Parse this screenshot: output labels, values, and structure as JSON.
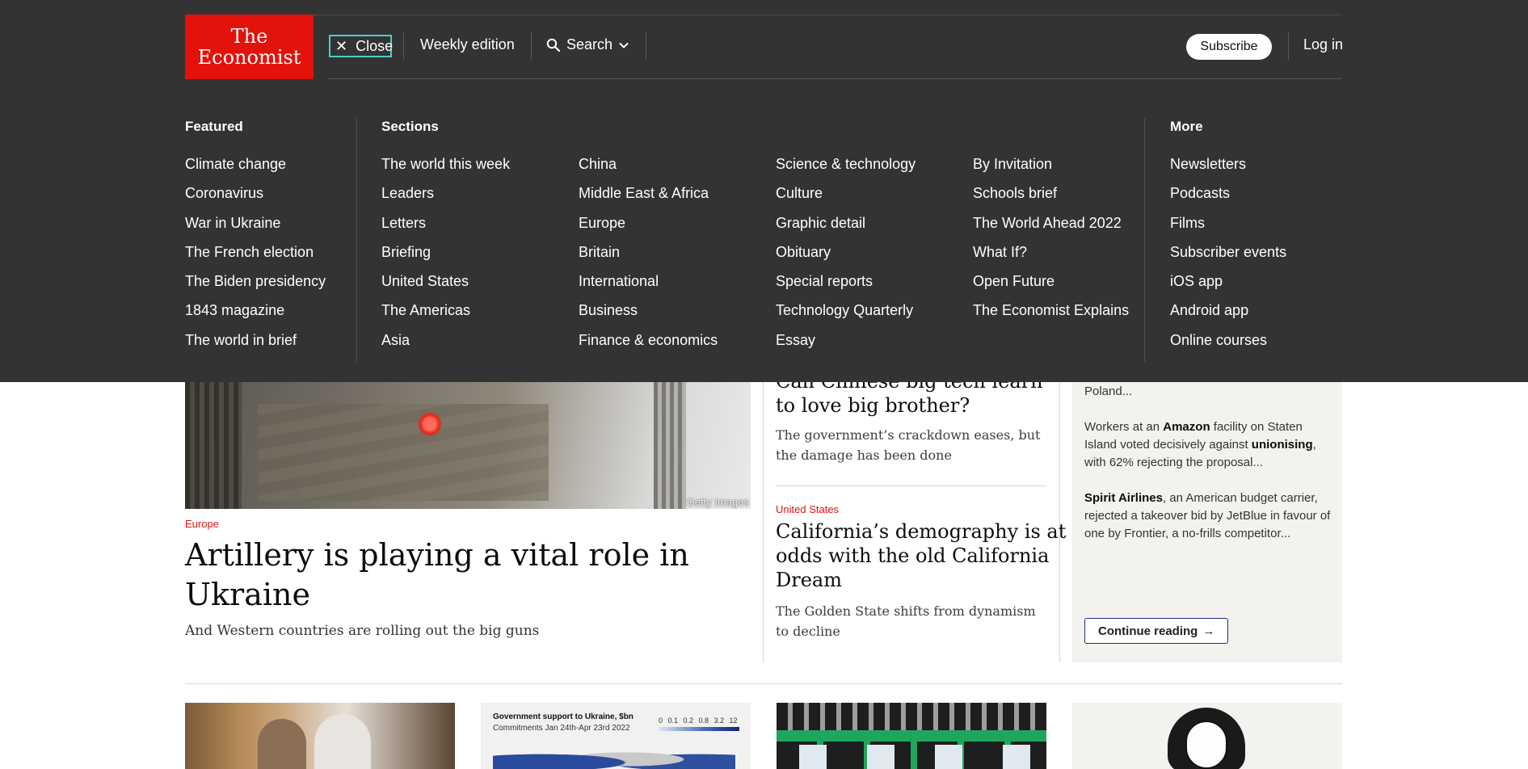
{
  "brand": {
    "logo_line1": "The",
    "logo_line2": "Economist",
    "color": "#e3120b"
  },
  "topbar": {
    "close_label": "Close",
    "weekly_label": "Weekly edition",
    "search_label": "Search",
    "subscribe_label": "Subscribe",
    "login_label": "Log in"
  },
  "menu": {
    "featured": {
      "heading": "Featured",
      "items": [
        "Climate change",
        "Coronavirus",
        "War in Ukraine",
        "The French election",
        "The Biden presidency",
        "1843 magazine",
        "The world in brief"
      ]
    },
    "sections": {
      "heading": "Sections",
      "col1": [
        "The world this week",
        "Leaders",
        "Letters",
        "Briefing",
        "United States",
        "The Americas",
        "Asia"
      ],
      "col2": [
        "China",
        "Middle East & Africa",
        "Europe",
        "Britain",
        "International",
        "Business",
        "Finance & economics"
      ],
      "col3": [
        "Science & technology",
        "Culture",
        "Graphic detail",
        "Obituary",
        "Special reports",
        "Technology Quarterly",
        "Essay"
      ],
      "col4": [
        "By Invitation",
        "Schools brief",
        "The World Ahead 2022",
        "What If?",
        "Open Future",
        "The Economist Explains"
      ]
    },
    "more": {
      "heading": "More",
      "items": [
        "Newsletters",
        "Podcasts",
        "Films",
        "Subscriber events",
        "iOS app",
        "Android app",
        "Online courses"
      ]
    }
  },
  "hero": {
    "image_credit": "Getty Images",
    "tag": "Europe",
    "title": "Artillery is playing a vital role in Ukraine",
    "subtitle": "And Western countries are rolling out the big guns"
  },
  "middle": {
    "story1_title": "Can Chinese big tech learn to love big brother?",
    "story1_sub": "The government’s crackdown eases, but the damage has been done",
    "story2_tag": "United States",
    "story2_title": "California’s demography is at odds with the old California Dream",
    "story2_sub": "The Golden State shifts from dynamism to decline"
  },
  "brief": {
    "p0": "Poland...",
    "p1_a": "Workers at an ",
    "p1_b": "Amazon",
    "p1_c": " facility on Staten Island voted decisively against ",
    "p1_d": "unionising",
    "p1_e": ", with 62% rejecting the proposal...",
    "p2_a": "Spirit Airlines",
    "p2_b": ", an American budget carrier, rejected a takeover bid by JetBlue in favour of one by Frontier, a no-frills competitor...",
    "continue_label": "Continue reading"
  },
  "thumbs": {
    "chart_title": "Government support to Ukraine, $bn",
    "chart_sub": "Commitments Jan 24th-Apr 23rd 2022",
    "chart_scale": "0 0.1 0.2 0.8 3.2 12"
  }
}
